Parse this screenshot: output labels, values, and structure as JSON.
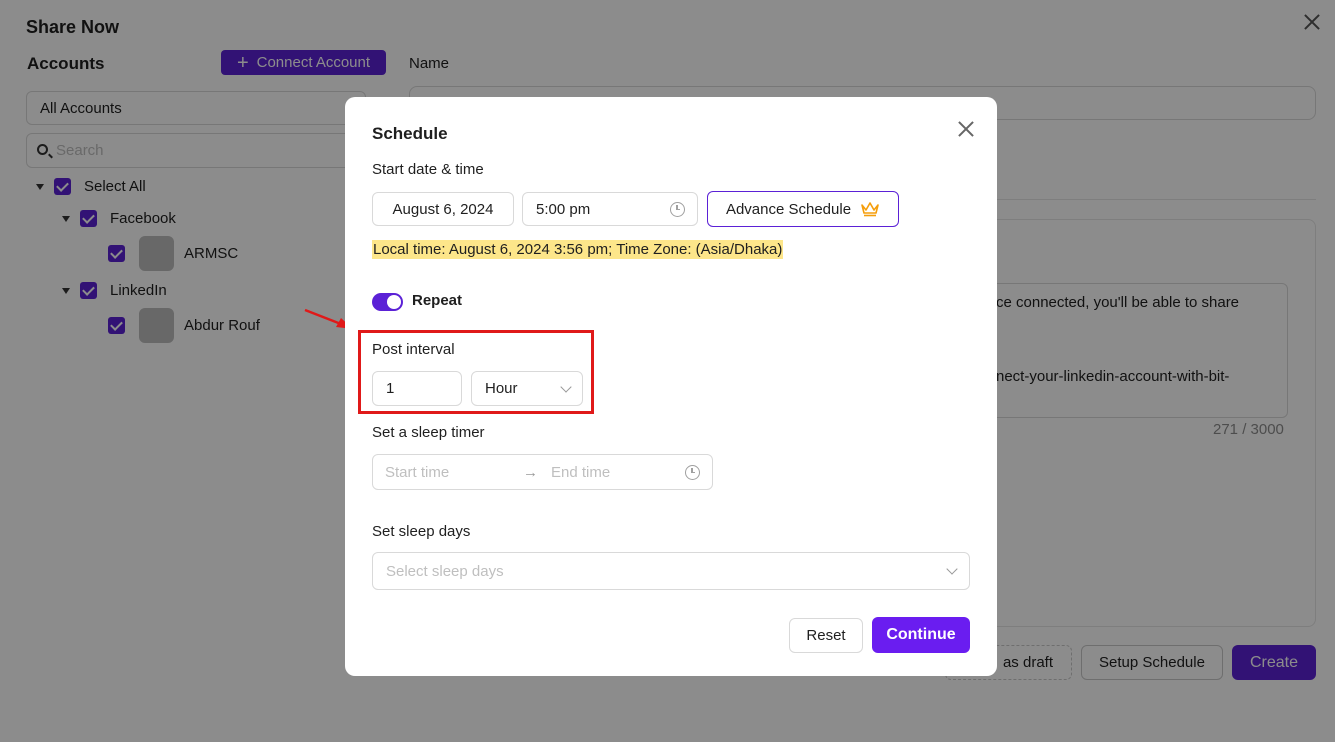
{
  "window": {
    "title": "Share Now"
  },
  "accounts": {
    "heading": "Accounts",
    "connect_label": "Connect Account",
    "filter_value": "All Accounts",
    "search_placeholder": "Search",
    "tree": {
      "select_all": "Select All",
      "facebook": {
        "label": "Facebook",
        "account": "ARMSC"
      },
      "linkedin": {
        "label": "LinkedIn",
        "account": "Abdur Rouf"
      }
    }
  },
  "editor": {
    "name_label": "Name",
    "text_line1": "ce connected, you'll be able to share",
    "text_line2": "nect-your-linkedin-account-with-bit-",
    "counter": "271 / 3000"
  },
  "footer": {
    "draft_label": "as draft",
    "setup_label": "Setup Schedule",
    "create_label": "Create"
  },
  "modal": {
    "title": "Schedule",
    "start_label": "Start date & time",
    "date_value": "August 6, 2024",
    "time_value": "5:00 pm",
    "advance_label": "Advance Schedule",
    "local_time": "Local time: August 6, 2024 3:56 pm; Time Zone: (Asia/Dhaka)",
    "repeat_label": "Repeat",
    "repeat_on": true,
    "interval_label": "Post interval",
    "interval_value": "1",
    "interval_unit": "Hour",
    "sleep_timer_label": "Set a sleep timer",
    "sleep_start_placeholder": "Start time",
    "sleep_arrow": "→",
    "sleep_end_placeholder": "End time",
    "sleep_days_label": "Set sleep days",
    "sleep_days_placeholder": "Select sleep days",
    "reset_label": "Reset",
    "continue_label": "Continue"
  },
  "colors": {
    "accent": "#5b21d6",
    "highlight_box": "#e01919",
    "local_time_bg": "#fde68a",
    "crown": "#f59e0b"
  },
  "icons": [
    "close-icon",
    "plus-icon",
    "search-icon",
    "caret-down-icon",
    "checkbox-icon",
    "clock-icon",
    "crown-icon",
    "chevron-down-icon",
    "arrow-icon"
  ]
}
